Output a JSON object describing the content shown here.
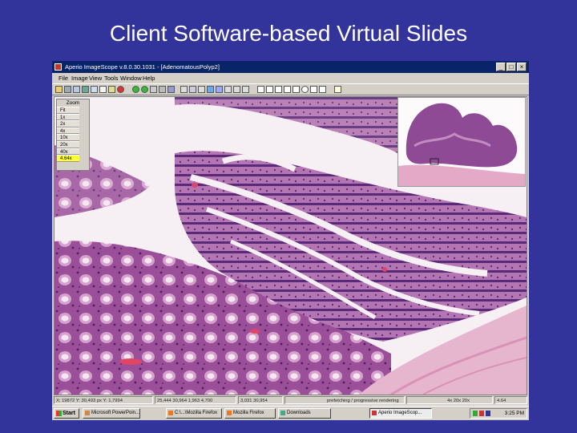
{
  "slide": {
    "title": "Client Software-based Virtual Slides"
  },
  "window": {
    "title": "Aperio ImageScope v.8.0.30.1031 - [AdenomatousPolyp2]",
    "buttons": {
      "minimize": "_",
      "maximize": "□",
      "close": "×"
    }
  },
  "menu": {
    "items": [
      "File",
      "Image",
      "View",
      "Tools",
      "Window",
      "Help"
    ]
  },
  "zoom": {
    "title": "Zoom",
    "levels": [
      "Fit",
      "1x",
      "2x",
      "4x",
      "10x",
      "20x",
      "40x",
      "4.64x"
    ],
    "selected": "4.64x"
  },
  "status": {
    "coords": "X: 19872  Y: 30,493 px  Y: 1,7994",
    "field2": "25,444  30,964  1,963  4,700",
    "field3": "3,031  30,954",
    "message": "prefetching / progressive rendering",
    "zoom": "4x  20x  20x",
    "scale": "4.64"
  },
  "taskbar": {
    "start": "Start",
    "tasks": [
      "Microsoft PowerPoin...",
      "C:\\...\\Mozilla Firefox",
      "Mozilla Firefox",
      "Downloads",
      "Aperio ImageScop..."
    ],
    "active_task": "Aperio ImageScop...",
    "clock": "3:25 PM"
  },
  "colors": {
    "slide_background": "#33339c",
    "titlebar": "#0a246a",
    "window_chrome": "#d4d0c8",
    "tissue_stain": "#8c3f8e",
    "tissue_pink": "#d79ec0",
    "zoom_highlight": "#ffff33"
  }
}
